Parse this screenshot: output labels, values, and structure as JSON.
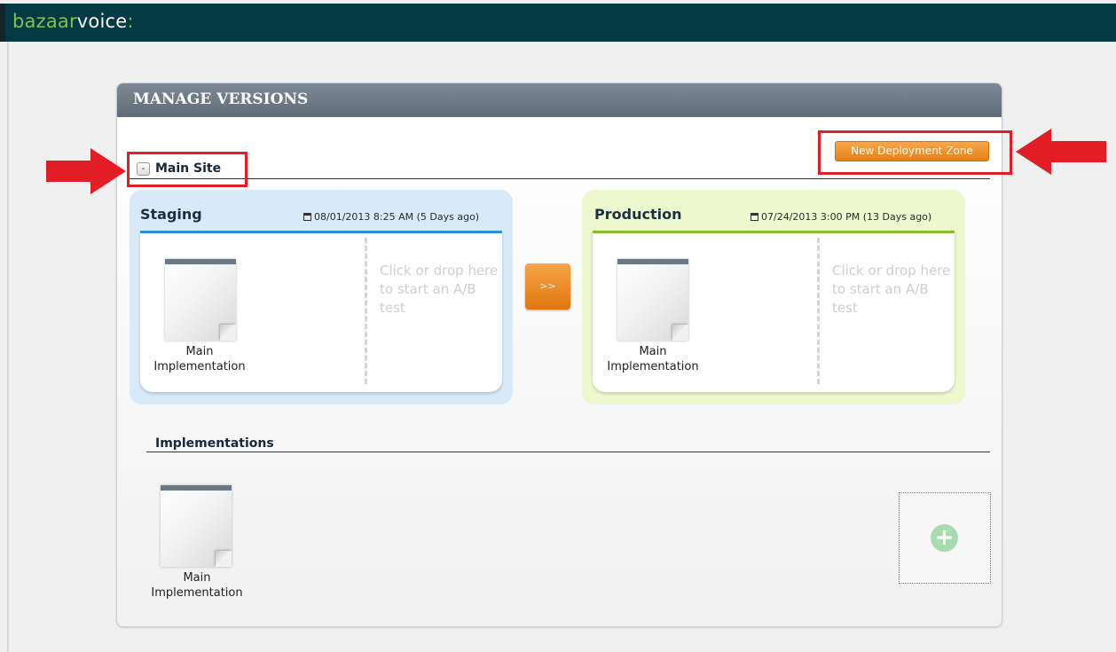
{
  "header": {
    "logo_part1": "bazaar",
    "logo_part2": "voice",
    "logo_part3": ":"
  },
  "panel": {
    "title": "MANAGE VERSIONS"
  },
  "zone": {
    "collapse_symbol": "-",
    "name": "Main Site",
    "new_zone_button": "New Deployment Zone"
  },
  "staging": {
    "title": "Staging",
    "date": "08/01/2013 8:25 AM (5 Days ago)",
    "implementation_label": "Main Implementation",
    "ab_test_text": "Click or drop here to start an A/B test"
  },
  "promote_button": ">>",
  "production": {
    "title": "Production",
    "date": "07/24/2013 3:00 PM (13 Days ago)",
    "implementation_label": "Main Implementation",
    "ab_test_text": "Click or drop here to start an A/B test"
  },
  "implementations": {
    "heading": "Implementations",
    "items": [
      {
        "label": "Main Implementation"
      }
    ],
    "add_symbol": "+"
  },
  "colors": {
    "topbar": "#043a44",
    "accent_orange": "#e57f17",
    "annotation_red": "#e21d25",
    "staging_bg": "#d8eaf8",
    "production_bg": "#eef8cf"
  },
  "icons": [
    "calendar-icon",
    "document-icon",
    "add-icon",
    "collapse-icon",
    "arrow-annotation"
  ]
}
